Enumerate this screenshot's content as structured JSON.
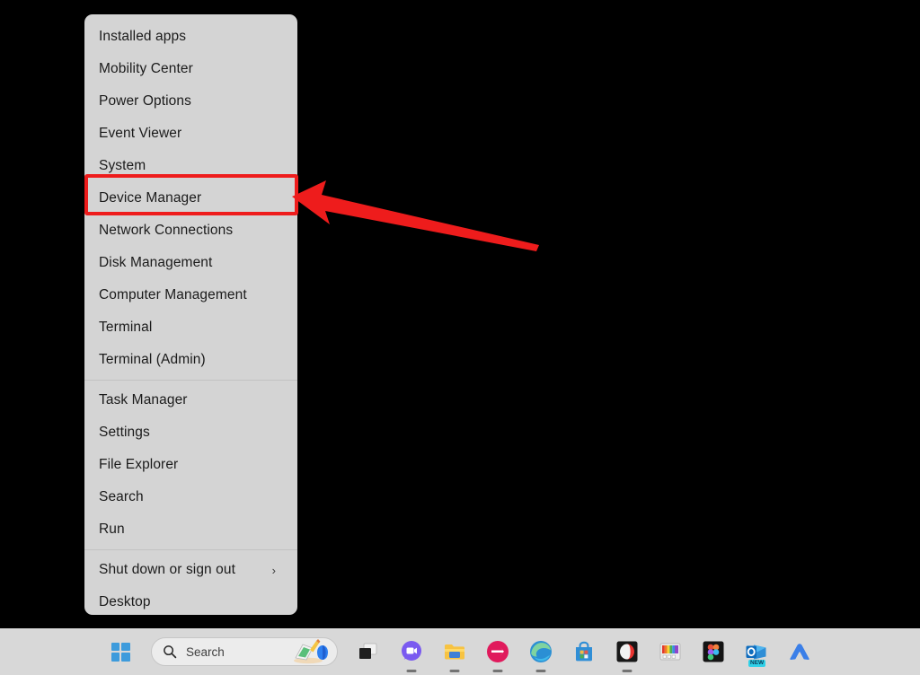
{
  "window": {
    "title": "Windows 11 desktop with Win+X power user menu open"
  },
  "menu": {
    "name": "win-x-power-user-menu",
    "groups": [
      {
        "items": [
          {
            "label": "Installed apps",
            "has_submenu": false
          },
          {
            "label": "Mobility Center",
            "has_submenu": false
          },
          {
            "label": "Power Options",
            "has_submenu": false
          },
          {
            "label": "Event Viewer",
            "has_submenu": false
          },
          {
            "label": "System",
            "has_submenu": false
          },
          {
            "label": "Device Manager",
            "has_submenu": false,
            "highlighted": true
          },
          {
            "label": "Network Connections",
            "has_submenu": false
          },
          {
            "label": "Disk Management",
            "has_submenu": false
          },
          {
            "label": "Computer Management",
            "has_submenu": false
          },
          {
            "label": "Terminal",
            "has_submenu": false
          },
          {
            "label": "Terminal (Admin)",
            "has_submenu": false
          }
        ]
      },
      {
        "items": [
          {
            "label": "Task Manager",
            "has_submenu": false
          },
          {
            "label": "Settings",
            "has_submenu": false
          },
          {
            "label": "File Explorer",
            "has_submenu": false
          },
          {
            "label": "Search",
            "has_submenu": false
          },
          {
            "label": "Run",
            "has_submenu": false
          }
        ]
      },
      {
        "items": [
          {
            "label": "Shut down or sign out",
            "has_submenu": true,
            "submenu_glyph": "›"
          },
          {
            "label": "Desktop",
            "has_submenu": false
          }
        ]
      }
    ]
  },
  "annotation": {
    "highlight_target": "Device Manager",
    "box_color": "#ee1c1c",
    "arrow_color": "#ee1c1c",
    "arrow_points_to": "Device Manager"
  },
  "taskbar": {
    "background": "#d8d8d8",
    "start_button": {
      "name": "start-button",
      "label": "Start"
    },
    "search": {
      "placeholder": "Search",
      "value": "Search",
      "icon": "search-icon"
    },
    "buttons": [
      {
        "name": "task-view-button",
        "label": "Task View",
        "icon": "task-view-icon",
        "running": false
      },
      {
        "name": "chat-button",
        "label": "Chat",
        "icon": "chat-video-icon",
        "running": true
      },
      {
        "name": "file-explorer-button",
        "label": "File Explorer",
        "icon": "folder-icon",
        "running": true
      },
      {
        "name": "pinned-app-button",
        "label": "Pinned app",
        "icon": "red-circle-arrow-icon",
        "running": true
      },
      {
        "name": "edge-button",
        "label": "Microsoft Edge",
        "icon": "edge-icon",
        "running": true
      },
      {
        "name": "store-button",
        "label": "Microsoft Store",
        "icon": "store-bag-icon",
        "running": false
      },
      {
        "name": "opera-button",
        "label": "Opera GX",
        "icon": "opera-gx-icon",
        "running": true
      },
      {
        "name": "color-picker-button",
        "label": "Color picker",
        "icon": "color-palette-icon",
        "running": false
      },
      {
        "name": "figma-button",
        "label": "Figma",
        "icon": "figma-icon",
        "running": false
      },
      {
        "name": "outlook-button",
        "label": "Outlook (new)",
        "icon": "outlook-icon",
        "badge": "NEW",
        "running": false
      },
      {
        "name": "vpn-button",
        "label": "NordVPN",
        "icon": "nord-arc-icon",
        "running": false
      }
    ]
  },
  "colors": {
    "menu_background": "#d4d4d4",
    "menu_text": "#1b1b1b",
    "separator": "#c2c2c2",
    "desktop": "#000000",
    "accent_red": "#ee1c1c"
  }
}
